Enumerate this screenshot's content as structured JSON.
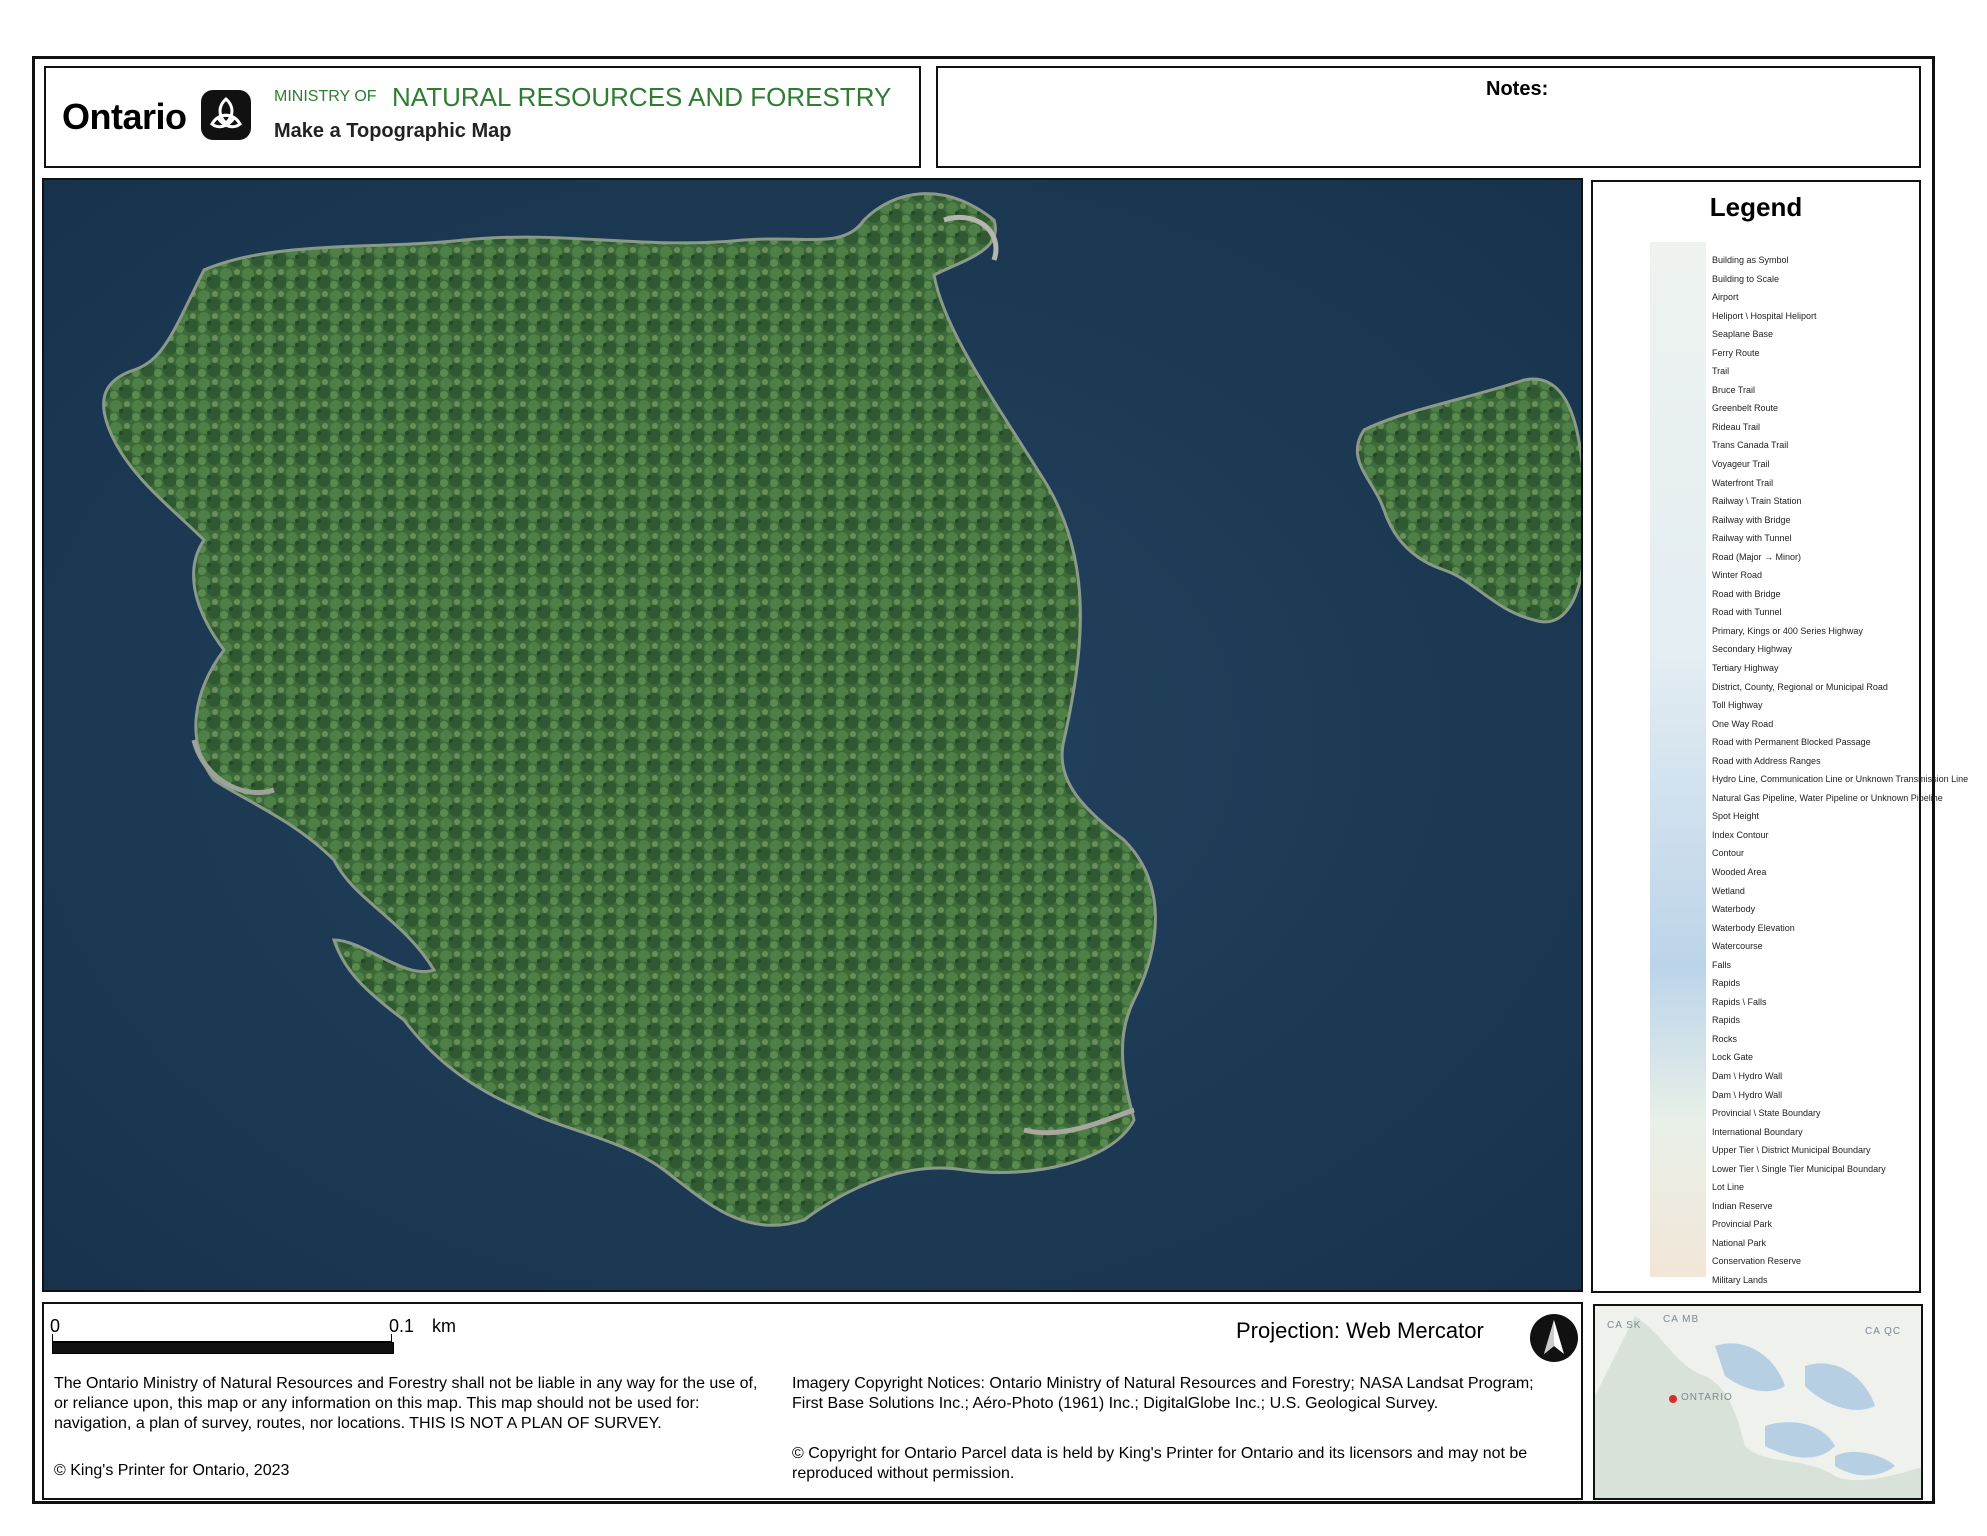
{
  "header": {
    "logo_text": "Ontario",
    "ministry_prefix": "MINISTRY OF",
    "ministry_name": "NATURAL RESOURCES AND FORESTRY",
    "app_title": "Make a Topographic Map"
  },
  "notes": {
    "label": "Notes:"
  },
  "map": {
    "main_island": "aerial imagery, forested island",
    "water_color": "#1d3a52",
    "forest_color": "#3f6e3c"
  },
  "legend": {
    "title": "Legend",
    "items": [
      {
        "label": "Building as Symbol"
      },
      {
        "label": "Building to Scale"
      },
      {
        "label": "Airport"
      },
      {
        "label": "Heliport \\ Hospital Heliport"
      },
      {
        "label": "Seaplane Base"
      },
      {
        "label": "Ferry Route"
      },
      {
        "label": "Trail"
      },
      {
        "label": "Bruce Trail"
      },
      {
        "label": "Greenbelt Route"
      },
      {
        "label": "Rideau Trail"
      },
      {
        "label": "Trans Canada Trail"
      },
      {
        "label": "Voyageur Trail"
      },
      {
        "label": "Waterfront Trail"
      },
      {
        "label": "Railway \\ Train Station"
      },
      {
        "label": "Railway with Bridge"
      },
      {
        "label": "Railway with Tunnel"
      },
      {
        "label": "Road (Major → Minor)"
      },
      {
        "label": "Winter Road"
      },
      {
        "label": "Road with Bridge"
      },
      {
        "label": "Road with Tunnel"
      },
      {
        "label": "Primary, Kings or 400 Series Highway"
      },
      {
        "label": "Secondary Highway"
      },
      {
        "label": "Tertiary Highway"
      },
      {
        "label": "District, County, Regional or Municipal Road"
      },
      {
        "label": "Toll Highway"
      },
      {
        "label": "One Way Road"
      },
      {
        "label": "Road with Permanent Blocked Passage"
      },
      {
        "label": "Road with Address Ranges"
      },
      {
        "label": "Hydro Line, Communication Line or Unknown Transmission Line"
      },
      {
        "label": "Natural Gas Pipeline, Water Pipeline or Unknown Pipeline"
      },
      {
        "label": "Spot Height"
      },
      {
        "label": "Index Contour"
      },
      {
        "label": "Contour"
      },
      {
        "label": "Wooded Area"
      },
      {
        "label": "Wetland"
      },
      {
        "label": "Waterbody"
      },
      {
        "label": "Waterbody Elevation"
      },
      {
        "label": "Watercourse"
      },
      {
        "label": "Falls"
      },
      {
        "label": "Rapids"
      },
      {
        "label": "Rapids \\ Falls"
      },
      {
        "label": "Rapids"
      },
      {
        "label": "Rocks"
      },
      {
        "label": "Lock Gate"
      },
      {
        "label": "Dam \\ Hydro Wall"
      },
      {
        "label": "Dam \\ Hydro Wall"
      },
      {
        "label": "Provincial \\ State Boundary"
      },
      {
        "label": "International Boundary"
      },
      {
        "label": "Upper Tier \\ District Municipal Boundary"
      },
      {
        "label": "Lower Tier \\ Single Tier Municipal Boundary"
      },
      {
        "label": "Lot Line"
      },
      {
        "label": "Indian Reserve"
      },
      {
        "label": "Provincial Park"
      },
      {
        "label": "National Park"
      },
      {
        "label": "Conservation Reserve"
      },
      {
        "label": "Military Lands"
      }
    ]
  },
  "scale": {
    "start": "0",
    "end": "0.1",
    "unit": "km"
  },
  "projection": "Projection: Web Mercator",
  "disclaimer": "The Ontario Ministry of Natural Resources and Forestry shall not be liable in any way for the use of, or reliance upon, this map or any information on this map.  This map should not be used for: navigation, a plan of survey, routes, nor locations. THIS IS NOT A PLAN OF SURVEY.",
  "copyright": "© King's Printer for Ontario,  2023",
  "imagery_notice": "Imagery Copyright Notices: Ontario Ministry of Natural Resources and Forestry; NASA Landsat Program; First Base Solutions Inc.; Aéro-Photo (1961) Inc.; DigitalGlobe Inc.; U.S. Geological Survey.",
  "parcel_notice": "© Copyright for Ontario Parcel data is held by King's Printer for Ontario and its licensors and may not be reproduced without permission.",
  "inset": {
    "labels": [
      "CA SK",
      "CA MB",
      "CA QC",
      "ONTARIO"
    ]
  }
}
